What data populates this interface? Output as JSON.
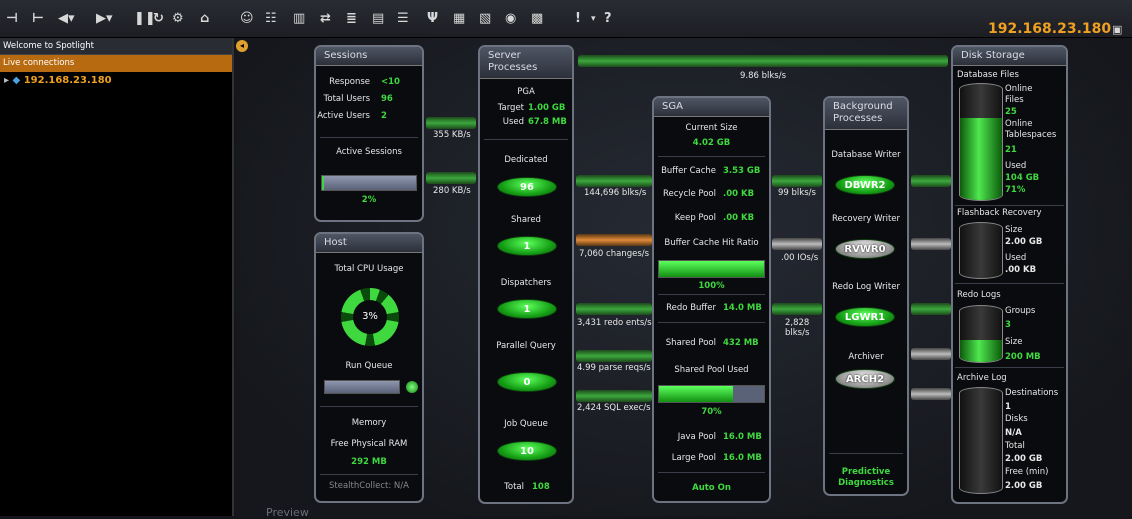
{
  "toolbar": {
    "buttons": [
      "pin-icon",
      "pin2-icon",
      "back-icon",
      "forward-icon",
      "pause-icon",
      "refresh-icon",
      "settings-icon",
      "home-icon",
      "users-icon",
      "sql-icon",
      "chart-icon",
      "swap-icon",
      "align-icon",
      "list-icon",
      "db-icon",
      "fork-icon",
      "doc-icon",
      "report-icon",
      "globe-icon",
      "calc-icon",
      "alert-icon",
      "help-icon"
    ],
    "alert_label": "!",
    "help_label": "?"
  },
  "sidebar": {
    "welcome": "Welcome to Spotlight",
    "section": "Live connections",
    "connection": "192.168.23.180"
  },
  "header": {
    "ip": "192.168.23.180"
  },
  "sessions": {
    "title": "Sessions",
    "response_label": "Response",
    "response_value": "<10",
    "total_label": "Total Users",
    "total_value": "96",
    "active_label": "Active Users",
    "active_value": "2",
    "active_sessions_label": "Active Sessions",
    "active_sessions_pct": "2%",
    "active_sessions_fill": 0.02
  },
  "host": {
    "title": "Host",
    "cpu_label": "Total CPU Usage",
    "cpu_value": "3%",
    "run_queue_label": "Run Queue",
    "memory_label": "Memory",
    "free_ram_label": "Free Physical RAM",
    "free_ram_value": "292 MB",
    "stealth": "StealthCollect: N/A"
  },
  "server": {
    "title1": "Server",
    "title2": "Processes",
    "pga_label": "PGA",
    "target_label": "Target",
    "target_value": "1.00 GB",
    "used_label": "Used",
    "used_value": "67.8 MB",
    "dedicated_label": "Dedicated",
    "dedicated_value": "96",
    "shared_label": "Shared",
    "shared_value": "1",
    "dispatchers_label": "Dispatchers",
    "dispatchers_value": "1",
    "parallel_label": "Parallel Query",
    "parallel_value": "0",
    "job_label": "Job Queue",
    "job_value": "10",
    "total_label": "Total",
    "total_value": "108"
  },
  "sga": {
    "title": "SGA",
    "current_label": "Current Size",
    "current_value": "4.02 GB",
    "buffer_label": "Buffer Cache",
    "buffer_value": "3.53 GB",
    "recycle_label": "Recycle Pool",
    "recycle_value": ".00 KB",
    "keep_label": "Keep Pool",
    "keep_value": ".00 KB",
    "hit_label": "Buffer Cache Hit Ratio",
    "hit_value": "100%",
    "hit_fill": 1.0,
    "redo_label": "Redo Buffer",
    "redo_value": "14.0 MB",
    "shared_pool_label": "Shared Pool",
    "shared_pool_value": "432 MB",
    "shared_used_label": "Shared Pool Used",
    "shared_used_value": "70%",
    "shared_used_fill": 0.7,
    "java_label": "Java Pool",
    "java_value": "16.0 MB",
    "large_label": "Large Pool",
    "large_value": "16.0 MB",
    "auto": "Auto On"
  },
  "background": {
    "title1": "Background",
    "title2": "Processes",
    "dbwr_label": "Database Writer",
    "dbwr_value": "DBWR2",
    "rvwr_label": "Recovery Writer",
    "rvwr_value": "RVWR0",
    "lgwr_label": "Redo Log Writer",
    "lgwr_value": "LGWR1",
    "arch_label": "Archiver",
    "arch_value": "ARCH2",
    "predictive1": "Predictive",
    "predictive2": "Diagnostics"
  },
  "disk": {
    "title": "Disk Storage",
    "dbfiles_label": "Database Files",
    "online_files_label1": "Online",
    "online_files_label2": "Files",
    "online_files_value": "25",
    "online_ts_label1": "Online",
    "online_ts_label2": "Tablespaces",
    "online_ts_value": "21",
    "used_label": "Used",
    "used_value": "104 GB",
    "used_pct": "71%",
    "db_fill": 0.71,
    "flash_label": "Flashback Recovery",
    "flash_size_label": "Size",
    "flash_size_value": "2.00 GB",
    "flash_used_label": "Used",
    "flash_used_value": ".00 KB",
    "flash_fill": 0.0,
    "redo_label": "Redo Logs",
    "groups_label": "Groups",
    "groups_value": "3",
    "redo_size_label": "Size",
    "redo_size_value": "200 MB",
    "redo_fill": 0.4,
    "archive_label": "Archive Log",
    "dest_label": "Destinations",
    "dest_value": "1",
    "disks_label": "Disks",
    "disks_value": "N/A",
    "total_label": "Total",
    "total_value": "2.00 GB",
    "free_label": "Free (min)",
    "free_value": "2.00 GB",
    "archive_fill": 0.0
  },
  "flows": {
    "top": "9.86 blks/s",
    "kb1": "355 KB/s",
    "kb2": "280 KB/s",
    "blks": "144,696 blks/s",
    "changes": "7,060 changes/s",
    "redo_ents": "3,431 redo ents/s",
    "parse": "4.99 parse reqs/s",
    "sql": "2,424 SQL exec/s",
    "blks99": "99 blks/s",
    "ios": ".00 IOs/s",
    "blks2828a": "2,828",
    "blks2828b": "blks/s"
  },
  "footer": {
    "preview": "Preview"
  },
  "colors": {
    "accent": "#f0a020",
    "green": "#3fd83f"
  }
}
